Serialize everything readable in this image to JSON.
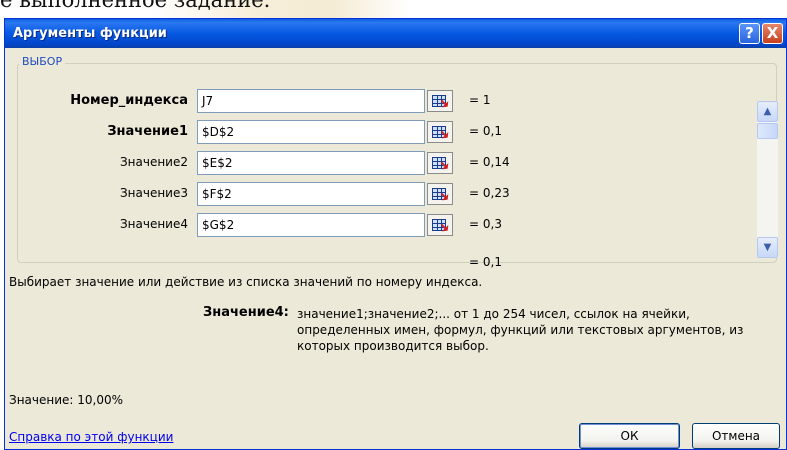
{
  "document": {
    "text": "е выполненное задание."
  },
  "dialog": {
    "title": "Аргументы функции",
    "help_button": "?",
    "close_button": "X"
  },
  "group": {
    "label": "ВЫБОР"
  },
  "arguments": [
    {
      "label": "Номер_индекса",
      "value": "J7",
      "result": "=  1",
      "bold": true
    },
    {
      "label": "Значение1",
      "value": "$D$2",
      "result": "=  0,1",
      "bold": true
    },
    {
      "label": "Значение2",
      "value": "$E$2",
      "result": "=  0,14",
      "bold": false
    },
    {
      "label": "Значение3",
      "value": "$F$2",
      "result": "=  0,23",
      "bold": false
    },
    {
      "label": "Значение4",
      "value": "$G$2",
      "result": "=  0,3",
      "bold": false
    }
  ],
  "total_result": "=  0,1",
  "description": "Выбирает значение или действие из списка значений по номеру индекса.",
  "argument_help": {
    "label": "Значение4:",
    "text": "значение1;значение2;... от 1 до 254 чисел, ссылок на ячейки, определенных имен, формул, функций или текстовых аргументов, из которых производится выбор."
  },
  "value_line": "Значение:  10,00%",
  "help_link": "Справка по этой функции",
  "buttons": {
    "ok": "ОК",
    "cancel": "Отмена"
  },
  "icons": {
    "help": "help-icon",
    "close": "close-icon",
    "ref": "collapse-dialog-icon",
    "scroll_up": "scroll-up-icon",
    "scroll_down": "scroll-down-icon"
  },
  "colors": {
    "titlebar": "#0558e2",
    "dialog_bg": "#ece9d8",
    "group_label": "#1f4cbf",
    "link": "#0000ee",
    "close": "#c7401c"
  }
}
